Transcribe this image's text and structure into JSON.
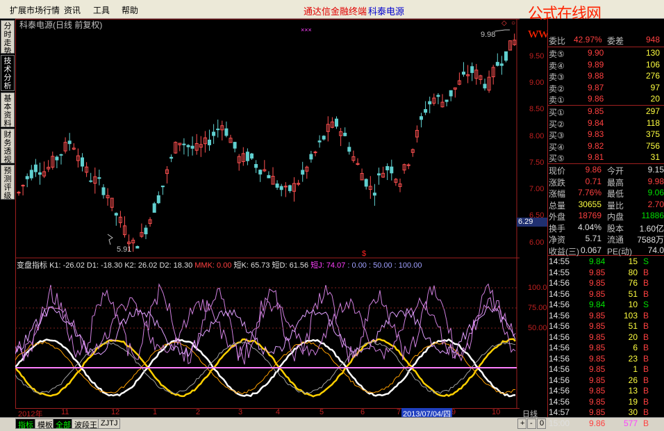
{
  "menu": {
    "items": [
      "扩展市场行情",
      "资讯",
      "工具",
      "帮助"
    ],
    "center_red": "通达信金融终端",
    "center_blue": "科泰电源",
    "watermark": "公式在线网www.gszx.com.cn"
  },
  "left_tabs": [
    "分时走势",
    "技术分析",
    "基本资料",
    "财务透视",
    "预测评级"
  ],
  "price_chart": {
    "title": "科泰电源(日线 前复权)",
    "hi_marker": "9.98",
    "lo_marker": "5.91",
    "axis_ticks": [
      "9.50",
      "9.00",
      "8.50",
      "8.00",
      "7.50",
      "7.00",
      "6.50",
      "6.00"
    ],
    "current_tag": "6.29",
    "x_markers": "×××",
    "s_marker": "$"
  },
  "indicator": {
    "name": "变盘指标",
    "k1": "K1: -26.02",
    "d1": "D1: -18.30",
    "k2": "K2: 26.02",
    "d2": "D2: 18.30",
    "mmk": "MMK: 0.00",
    "dk": "短K: 65.73",
    "dd": "短D: 61.56",
    "dj": "短J: 74.07",
    "levels": ": 0.00 : 50.00 : 100.00",
    "axis_ticks": [
      "100.0",
      "75.00",
      "50.00"
    ]
  },
  "date_axis": {
    "labels": [
      "2012年",
      "11",
      "12",
      "1",
      "2",
      "3",
      "4",
      "5",
      "6",
      "7",
      "9",
      "10"
    ],
    "selected": "2013/07/04/四",
    "period": "日线"
  },
  "bottom_tabs": [
    "指标",
    "模板",
    "全部",
    "波段王",
    "ZJTJ"
  ],
  "bottom_controls": [
    "+",
    "-",
    "0"
  ],
  "quote": {
    "weibi": {
      "label": "委比",
      "value": "42.97%",
      "label2": "委差",
      "value2": "948"
    },
    "asks": [
      {
        "label": "卖⑤",
        "price": "9.90",
        "vol": "130"
      },
      {
        "label": "卖④",
        "price": "9.89",
        "vol": "106"
      },
      {
        "label": "卖③",
        "price": "9.88",
        "vol": "276"
      },
      {
        "label": "卖②",
        "price": "9.87",
        "vol": "97"
      },
      {
        "label": "卖①",
        "price": "9.86",
        "vol": "20"
      }
    ],
    "bids": [
      {
        "label": "买①",
        "price": "9.85",
        "vol": "297"
      },
      {
        "label": "买②",
        "price": "9.84",
        "vol": "118"
      },
      {
        "label": "买③",
        "price": "9.83",
        "vol": "375"
      },
      {
        "label": "买④",
        "price": "9.82",
        "vol": "756"
      },
      {
        "label": "买⑤",
        "price": "9.81",
        "vol": "31"
      }
    ],
    "stats": [
      {
        "l1": "现价",
        "v1": "9.86",
        "l2": "今开",
        "v2": "9.15",
        "c1": "red",
        "c2": "wht"
      },
      {
        "l1": "涨跌",
        "v1": "0.71",
        "l2": "最高",
        "v2": "9.98",
        "c1": "red",
        "c2": "red"
      },
      {
        "l1": "涨幅",
        "v1": "7.76%",
        "l2": "最低",
        "v2": "9.06",
        "c1": "red",
        "c2": "grn"
      },
      {
        "l1": "总量",
        "v1": "30655",
        "l2": "量比",
        "v2": "2.70",
        "c1": "yel",
        "c2": "red"
      },
      {
        "l1": "外盘",
        "v1": "18769",
        "l2": "内盘",
        "v2": "11886",
        "c1": "red",
        "c2": "grn"
      },
      {
        "l1": "换手",
        "v1": "4.04%",
        "l2": "股本",
        "v2": "1.60亿",
        "c1": "wht",
        "c2": "wht"
      },
      {
        "l1": "净资",
        "v1": "5.71",
        "l2": "流通",
        "v2": "7588万",
        "c1": "wht",
        "c2": "wht"
      },
      {
        "l1": "收益(三)",
        "v1": "0.067",
        "l2": "PE(动)",
        "v2": "74.0",
        "c1": "wht",
        "c2": "wht"
      }
    ],
    "ticks": [
      {
        "t": "14:55",
        "p": "9.84",
        "v": "15",
        "s": "S"
      },
      {
        "t": "14:55",
        "p": "9.85",
        "v": "80",
        "s": "B"
      },
      {
        "t": "14:56",
        "p": "9.85",
        "v": "76",
        "s": "B"
      },
      {
        "t": "14:56",
        "p": "9.85",
        "v": "51",
        "s": "B"
      },
      {
        "t": "14:56",
        "p": "9.84",
        "v": "10",
        "s": "S"
      },
      {
        "t": "14:56",
        "p": "9.85",
        "v": "103",
        "s": "B"
      },
      {
        "t": "14:56",
        "p": "9.85",
        "v": "51",
        "s": "B"
      },
      {
        "t": "14:56",
        "p": "9.85",
        "v": "20",
        "s": "B"
      },
      {
        "t": "14:56",
        "p": "9.85",
        "v": "6",
        "s": "B"
      },
      {
        "t": "14:56",
        "p": "9.85",
        "v": "23",
        "s": "B"
      },
      {
        "t": "14:56",
        "p": "9.85",
        "v": "1",
        "s": "B"
      },
      {
        "t": "14:56",
        "p": "9.85",
        "v": "26",
        "s": "B"
      },
      {
        "t": "14:56",
        "p": "9.85",
        "v": "13",
        "s": "B"
      },
      {
        "t": "14:56",
        "p": "9.85",
        "v": "19",
        "s": "B"
      },
      {
        "t": "14:57",
        "p": "9.85",
        "v": "30",
        "s": "B"
      },
      {
        "t": "15:00",
        "p": "9.86",
        "v": "577",
        "s": "B"
      }
    ]
  }
}
